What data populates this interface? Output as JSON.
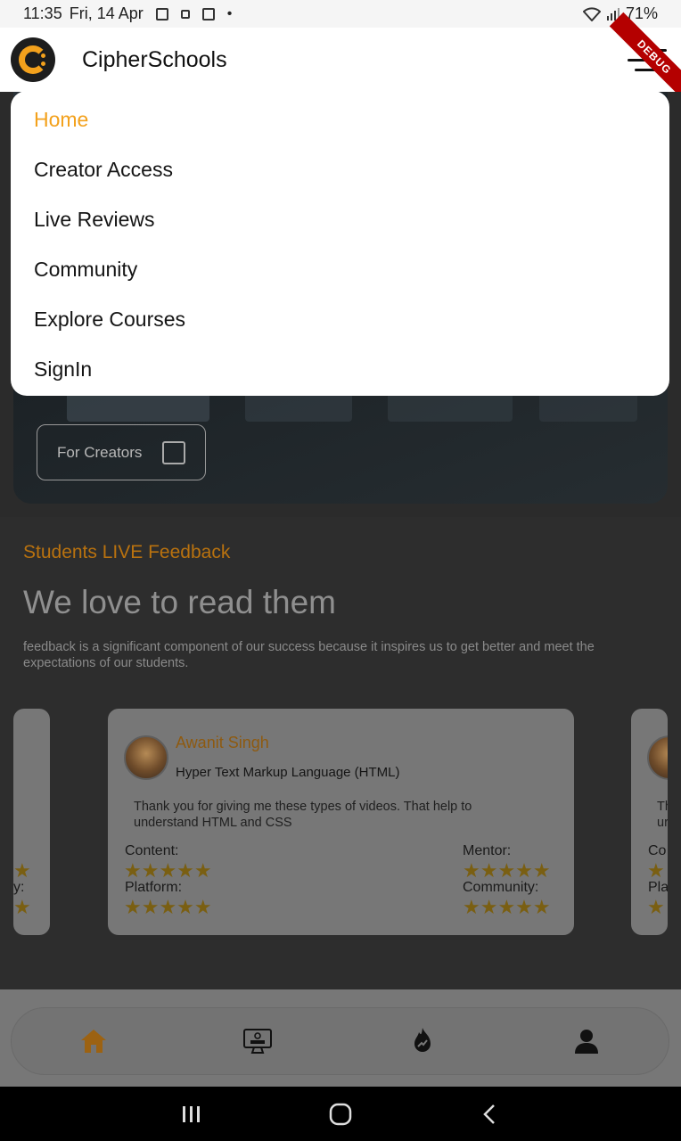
{
  "status_bar": {
    "time": "11:35",
    "date": "Fri, 14 Apr",
    "battery": "71%"
  },
  "app_bar": {
    "title": "CipherSchools",
    "debug_label": "DEBUG"
  },
  "menu": {
    "items": [
      {
        "label": "Home",
        "active": true
      },
      {
        "label": "Creator Access",
        "active": false
      },
      {
        "label": "Live Reviews",
        "active": false
      },
      {
        "label": "Community",
        "active": false
      },
      {
        "label": "Explore Courses",
        "active": false
      },
      {
        "label": "SignIn",
        "active": false
      }
    ]
  },
  "hero": {
    "creators_button": "For Creators"
  },
  "feedback": {
    "kicker": "Students LIVE Feedback",
    "title": "We love to read them",
    "description": "feedback is a significant component of our success because it inspires us to get better and meet the expectations of our students.",
    "card": {
      "name": "Awanit Singh",
      "course": "Hyper Text Markup Language (HTML)",
      "quote": "Thank you for giving me these types of videos. That help to understand HTML and CSS",
      "ratings": [
        {
          "label": "Content:",
          "stars": 5
        },
        {
          "label": "Mentor:",
          "stars": 5
        },
        {
          "label": "Platform:",
          "stars": 5
        },
        {
          "label": "Community:",
          "stars": 5
        }
      ],
      "stars_text": "★★★★★"
    },
    "left_peek": {
      "label_fragment": "y:",
      "stars_text": "★"
    },
    "right_peek": {
      "quote_fragment": "Th",
      "quote_fragment2": "ur",
      "label1": "Co",
      "label2": "Pla",
      "stars_text": "★"
    },
    "carousel": {
      "count": 9,
      "active_index": 1
    }
  },
  "bottom_nav": {
    "items": [
      {
        "name": "home",
        "icon": "home-icon",
        "active": true
      },
      {
        "name": "learn",
        "icon": "learn-monitor-icon",
        "active": false
      },
      {
        "name": "trending",
        "icon": "flame-icon",
        "active": false
      },
      {
        "name": "profile",
        "icon": "person-icon",
        "active": false
      }
    ]
  },
  "colors": {
    "accent": "#f3a11c",
    "dim_accent": "#b9720f"
  }
}
